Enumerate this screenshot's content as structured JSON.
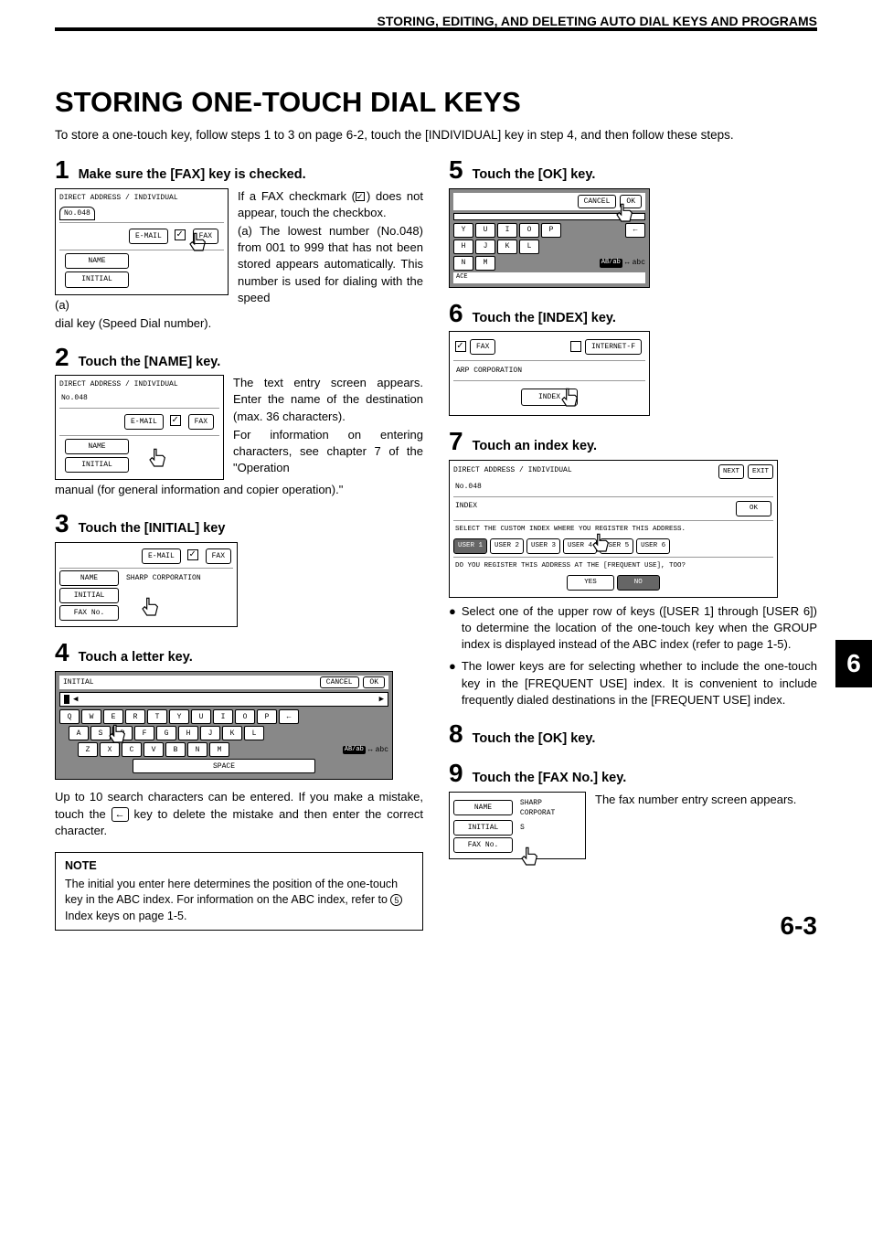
{
  "header": "STORING, EDITING, AND DELETING AUTO DIAL KEYS AND PROGRAMS",
  "title": "STORING ONE-TOUCH DIAL KEYS",
  "intro": "To store a one-touch key, follow steps 1 to 3 on  page 6-2, touch the [INDIVIDUAL] key in step 4, and then follow these steps.",
  "side_tab": "6",
  "page_number": "6-3",
  "steps": {
    "s1": {
      "num": "1",
      "title": "Make sure the [FAX] key is checked.",
      "fig": {
        "tabline": "DIRECT ADDRESS / INDIVIDUAL",
        "tab": "No.048",
        "email": "E-MAIL",
        "fax": "FAX",
        "name": "NAME",
        "initial": "INITIAL"
      },
      "caption_a": "(a)",
      "desc1": "If a FAX checkmark (",
      "desc1b": ") does not appear, touch the checkbox.",
      "desc2": "(a) The lowest number (No.048) from 001 to 999 that has not been stored appears automatically. This number is used for dialing with the speed",
      "after": "dial key (Speed Dial number)."
    },
    "s2": {
      "num": "2",
      "title": "Touch the [NAME] key.",
      "fig": {
        "tabline": "DIRECT ADDRESS / INDIVIDUAL",
        "no": "No.048",
        "email": "E-MAIL",
        "fax": "FAX",
        "name": "NAME",
        "initial": "INITIAL"
      },
      "desc1": "The text entry screen appears. Enter the name of the destination (max. 36 characters).",
      "desc2": "For information on entering characters, see chapter 7 of the \"Operation",
      "after": "manual (for general information and copier operation).\""
    },
    "s3": {
      "num": "3",
      "title": "Touch the [INITIAL] key",
      "fig": {
        "email": "E-MAIL",
        "fax": "FAX",
        "name": "NAME",
        "name_val": "SHARP CORPORATION",
        "initial": "INITIAL",
        "faxno": "FAX No."
      }
    },
    "s4": {
      "num": "4",
      "title": "Touch a letter key.",
      "kb": {
        "top_label": "INITIAL",
        "cancel": "CANCEL",
        "ok": "OK",
        "row1": [
          "Q",
          "W",
          "E",
          "R",
          "T",
          "Y",
          "U",
          "I",
          "O",
          "P"
        ],
        "row2": [
          "A",
          "S",
          "D",
          "F",
          "G",
          "H",
          "J",
          "K",
          "L"
        ],
        "row3": [
          "Z",
          "X",
          "C",
          "V",
          "B",
          "N",
          "M"
        ],
        "space": "SPACE",
        "mode": "AB/ab",
        "abc": "abc"
      },
      "desc": "Up to 10 search characters can be entered. If you make a mistake, touch the ",
      "desc2": " key to delete the mistake and then enter the correct character."
    },
    "note": {
      "title": "NOTE",
      "body_a": "The initial you enter here determines the position of the one-touch key in the ABC index. For information on the ABC index, refer to ",
      "circ": "5",
      "body_b": " Index keys on page 1-5."
    },
    "s5": {
      "num": "5",
      "title": "Touch the [OK] key.",
      "kb": {
        "cancel": "CANCEL",
        "ok": "OK",
        "row1": [
          "Y",
          "U",
          "I",
          "O",
          "P"
        ],
        "row2": [
          "H",
          "J",
          "K",
          "L"
        ],
        "row3": [
          "N",
          "M"
        ],
        "mode": "AB/ab",
        "abc": "abc",
        "bottom": "ACE"
      }
    },
    "s6": {
      "num": "6",
      "title": "Touch the [INDEX] key.",
      "fig": {
        "fax": "FAX",
        "internet": "INTERNET-F",
        "line": "ARP CORPORATION",
        "index": "INDEX"
      }
    },
    "s7": {
      "num": "7",
      "title": "Touch an index key.",
      "fig": {
        "tabline": "DIRECT ADDRESS / INDIVIDUAL",
        "next": "NEXT",
        "exit": "EXIT",
        "no": "No.048",
        "index": "INDEX",
        "ok": "OK",
        "prompt1": "SELECT THE CUSTOM INDEX WHERE YOU REGISTER THIS ADDRESS.",
        "users": [
          "USER 1",
          "USER 2",
          "USER 3",
          "USER 4",
          "USER 5",
          "USER 6"
        ],
        "prompt2": "DO YOU REGISTER THIS ADDRESS AT THE [FREQUENT USE], TOO?",
        "yes": "YES",
        "no_btn": "NO"
      },
      "b1": "Select one of the upper row of keys ([USER 1] through [USER 6]) to determine the location of the one-touch key when the GROUP index is displayed instead of the ABC index (refer to page 1-5).",
      "b2": "The lower keys are for selecting whether to include the one-touch key in the [FREQUENT USE] index. It is convenient to include frequently dialed destinations in the [FREQUENT USE] index."
    },
    "s8": {
      "num": "8",
      "title": "Touch the [OK] key."
    },
    "s9": {
      "num": "9",
      "title": "Touch the [FAX No.] key.",
      "fig": {
        "name": "NAME",
        "name_val": "SHARP CORPORAT",
        "initial": "INITIAL",
        "initial_val": "S",
        "faxno": "FAX No."
      },
      "desc": "The fax number entry screen appears."
    }
  }
}
